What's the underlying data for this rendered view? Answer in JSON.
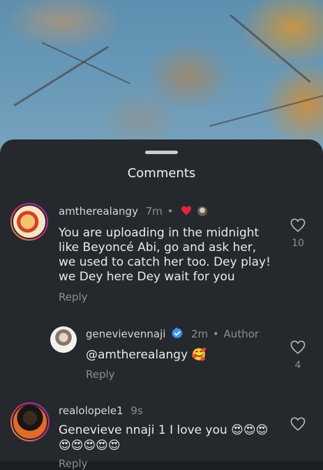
{
  "sheet": {
    "title": "Comments"
  },
  "comments": [
    {
      "username": "amtherealangy",
      "time": "7m",
      "separator": "•",
      "text": "You are uploading in the midnight like Beyoncé Abi, go and ask her, we used to catch her too. Dey play! we Dey here Dey wait for you",
      "reply_label": "Reply",
      "likes": "10"
    },
    {
      "username": "genevievennaji",
      "time": "2m",
      "separator": "•",
      "author_label": "Author",
      "text": "@amtherealangy 🥰",
      "reply_label": "Reply",
      "likes": "4"
    },
    {
      "username": "realolopele1",
      "time": "9s",
      "text_line1": "Genevieve nnaji 1 I love you 😍😍😍",
      "text_line2": "😍😍😍😍😍",
      "reply_label": "Reply"
    }
  ],
  "colors": {
    "sheet": "#25282d",
    "heart": "#e5233c",
    "verified": "#3897f0"
  }
}
